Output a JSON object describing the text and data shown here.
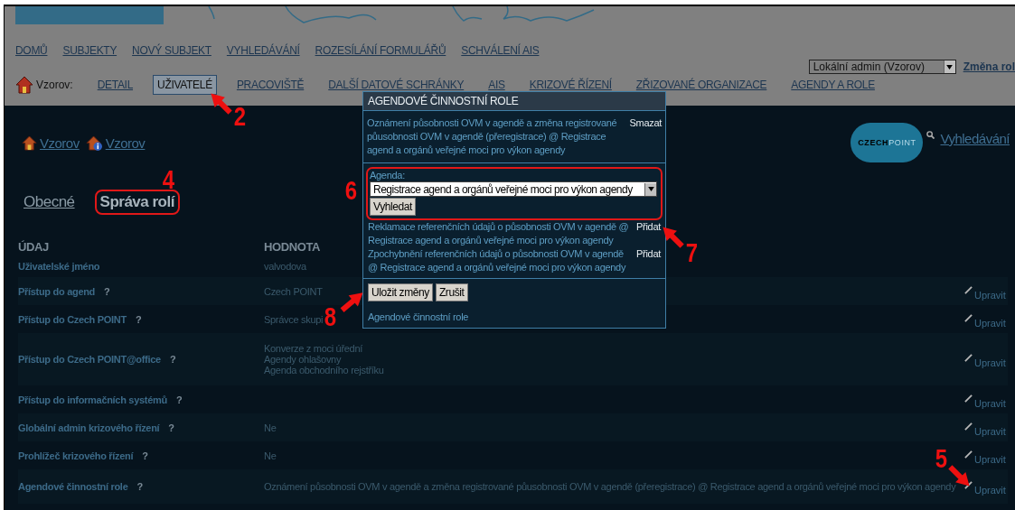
{
  "header": {
    "main_nav": [
      {
        "label": "DOMŮ"
      },
      {
        "label": "SUBJEKTY"
      },
      {
        "label": "NOVÝ SUBJEKT"
      },
      {
        "label": "VYHLEDÁVÁNÍ"
      },
      {
        "label": "ROZESÍLÁNÍ FORMULÁŘŮ"
      },
      {
        "label": "SCHVÁLENÍ AIS"
      }
    ],
    "org_label": "Vzorov:",
    "sub_nav": [
      {
        "label": "DETAIL",
        "selected": false
      },
      {
        "label": "UŽIVATELÉ",
        "selected": true
      },
      {
        "label": "PRACOVIŠTĚ",
        "selected": false
      },
      {
        "label": "DALŠÍ DATOVÉ SCHRÁNKY",
        "selected": false
      },
      {
        "label": "AIS",
        "selected": false
      },
      {
        "label": "KRIZOVÉ ŘÍZENÍ",
        "selected": false
      },
      {
        "label": "ZŘIZOVANÉ ORGANIZACE",
        "selected": false
      },
      {
        "label": "AGENDY A ROLE",
        "selected": false
      }
    ],
    "role_select": {
      "value": "Lokální admin (Vzorov)"
    },
    "role_link": "Změna rol"
  },
  "breadcrumbs": [
    {
      "label": "Vzorov",
      "kind": "home"
    },
    {
      "label": "Vzorov",
      "kind": "info"
    }
  ],
  "logo": {
    "part_1": "CZECH",
    "part_2": "POINT"
  },
  "search_link": "Vyhledávání",
  "tabs": [
    {
      "label": "Obecné",
      "selected": false,
      "highlighted": false
    },
    {
      "label": "Správa rolí",
      "selected": true,
      "highlighted": true
    }
  ],
  "table": {
    "columns": [
      "ÚDAJ",
      "HODNOTA"
    ],
    "rows": [
      {
        "label": "Uživatelské jméno",
        "help": false,
        "values": [
          "valvodova"
        ]
      },
      {
        "label": "Přístup do agend",
        "help": true,
        "values": [
          "Czech POINT"
        ],
        "action": "Upravit"
      },
      {
        "label": "Přístup do Czech POINT",
        "help": true,
        "values": [
          "Správce skupi"
        ],
        "action": "Upravit"
      },
      {
        "label": "Přístup do Czech POINT@office",
        "help": true,
        "values": [
          "Konverze z moci úřední",
          "Agendy ohlašovny",
          "Agenda obchodního rejstříku"
        ],
        "action": "Upravit"
      },
      {
        "label": "Přístup do informačních systémů",
        "help": true,
        "values": [],
        "action": "Upravit"
      },
      {
        "label": "Globální admin krizového řízení",
        "help": true,
        "values": [
          "Ne"
        ],
        "action": "Upravit"
      },
      {
        "label": "Prohlížeč krizového řízení",
        "help": true,
        "values": [
          "Ne"
        ],
        "action": "Upravit"
      },
      {
        "label": "Agendové činnostní role",
        "help": true,
        "values": [
          "Oznámení působnosti OVM v agendě a změna registrované půusobnosti OVM v agendě (přeregistrace) @ Registrace agend a orgánů veřejné moci pro výkon agendy"
        ],
        "action": "Upravit"
      }
    ]
  },
  "help_mark": "?",
  "modal": {
    "title": "AGENDOVÉ ČINNOSTNÍ ROLE",
    "assigned": [
      {
        "text": "Oznámení působnosti OVM v agendě a změna registrované půusobnosti OVM v agendě (přeregistrace) @ Registrace agend a orgánů veřejné moci pro výkon agendy",
        "action": "Smazat"
      }
    ],
    "agenda": {
      "label": "Agenda:",
      "value": "Registrace agend a orgánů veřejné moci pro výkon agendy",
      "button": "Vyhledat",
      "highlighted": true
    },
    "available": [
      {
        "text": "Reklamace referenčních údajů o působnosti OVM v agendě @ Registrace agend a orgánů veřejné moci pro výkon agendy",
        "action": "Přidat"
      },
      {
        "text": "Zpochybnění referenčních údajů o působnosti OVM v agendě @ Registrace agend a orgánů veřejné moci pro výkon agendy",
        "action": "Přidat"
      }
    ],
    "buttons": [
      "Uložit změny",
      "Zrušit"
    ],
    "footer": "Agendové činnostní role"
  },
  "annotations": [
    {
      "label": "2"
    },
    {
      "label": "4"
    },
    {
      "label": "5"
    },
    {
      "label": "6"
    },
    {
      "label": "7"
    },
    {
      "label": "8"
    }
  ]
}
